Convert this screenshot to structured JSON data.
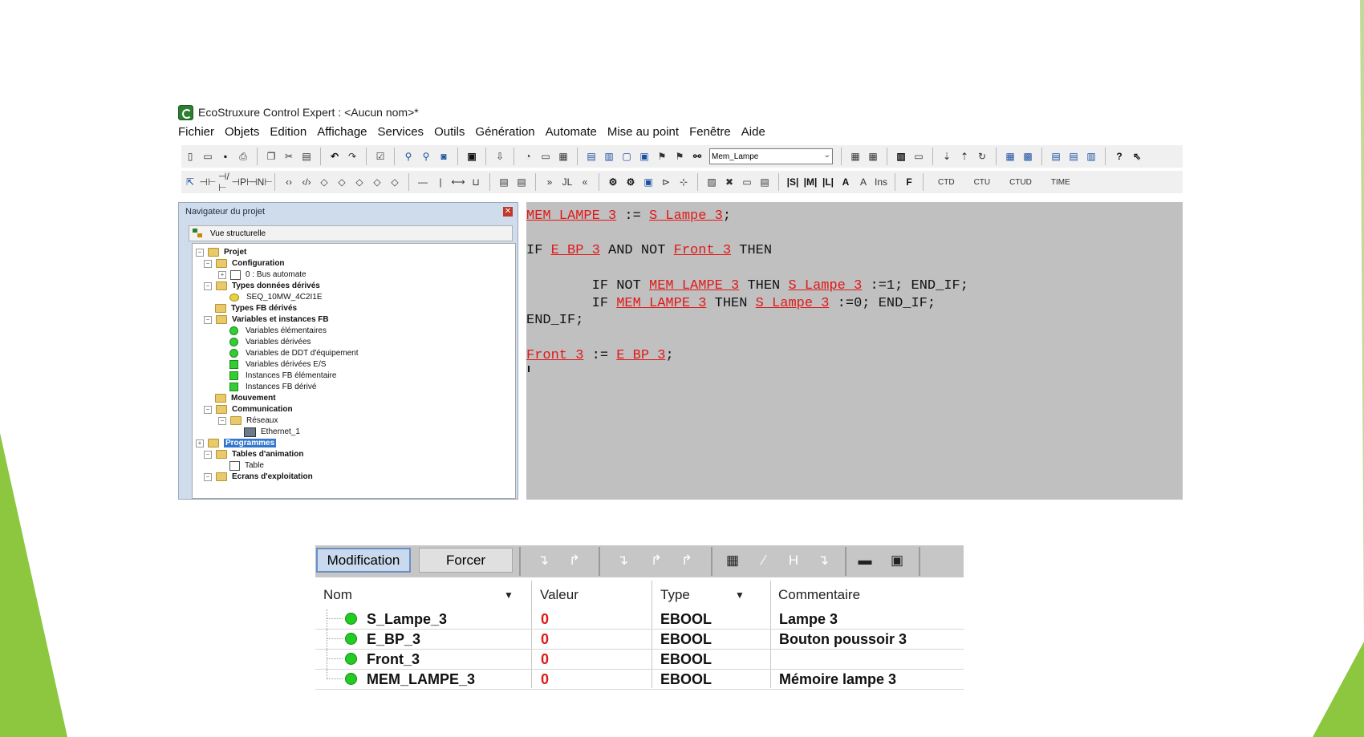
{
  "window": {
    "title": "EcoStruxure Control Expert : <Aucun nom>*"
  },
  "menu": [
    "Fichier",
    "Objets",
    "Edition",
    "Affichage",
    "Services",
    "Outils",
    "Génération",
    "Automate",
    "Mise au point",
    "Fenêtre",
    "Aide"
  ],
  "toolbar": {
    "search_value": "Mem_Lampe",
    "labels": [
      "Ins",
      "F",
      "CTD",
      "CTU",
      "CTUD",
      "TIME"
    ]
  },
  "navigator": {
    "title": "Navigateur du projet",
    "view_tab": "Vue structurelle",
    "tree": [
      {
        "label": "Projet",
        "bold": true
      },
      {
        "label": "Configuration",
        "bold": true
      },
      {
        "label": "0 : Bus automate",
        "bold": false
      },
      {
        "label": "Types données dérivés",
        "bold": true
      },
      {
        "label": "SEQ_10MW_4C2I1E",
        "bold": false
      },
      {
        "label": "Types FB dérivés",
        "bold": true
      },
      {
        "label": "Variables et instances FB",
        "bold": true
      },
      {
        "label": "Variables élémentaires",
        "bold": false
      },
      {
        "label": "Variables dérivées",
        "bold": false
      },
      {
        "label": "Variables de DDT d'équipement",
        "bold": false
      },
      {
        "label": "Variables dérivées E/S",
        "bold": false
      },
      {
        "label": "Instances FB élémentaire",
        "bold": false
      },
      {
        "label": "Instances FB dérivé",
        "bold": false
      },
      {
        "label": "Mouvement",
        "bold": true
      },
      {
        "label": "Communication",
        "bold": true
      },
      {
        "label": "Réseaux",
        "bold": false
      },
      {
        "label": "Ethernet_1",
        "bold": false
      },
      {
        "label": "Programmes",
        "bold": true,
        "selected": true
      },
      {
        "label": "Tables d'animation",
        "bold": true
      },
      {
        "label": "Table",
        "bold": false
      },
      {
        "label": "Ecrans d'exploitation",
        "bold": true
      }
    ]
  },
  "editor": {
    "lines": [
      [
        {
          "t": "MEM_LAMPE_3",
          "v": true
        },
        {
          "t": " := ",
          "v": false
        },
        {
          "t": "S_Lampe_3",
          "v": true
        },
        {
          "t": ";",
          "v": false
        }
      ],
      [],
      [
        {
          "t": "IF ",
          "v": false
        },
        {
          "t": "E_BP_3",
          "v": true
        },
        {
          "t": " AND NOT ",
          "v": false
        },
        {
          "t": "Front_3",
          "v": true
        },
        {
          "t": " THEN",
          "v": false
        }
      ],
      [],
      [
        {
          "t": "        IF NOT ",
          "v": false
        },
        {
          "t": "MEM_LAMPE_3",
          "v": true
        },
        {
          "t": " THEN ",
          "v": false
        },
        {
          "t": "S_Lampe_3",
          "v": true
        },
        {
          "t": " :=1; END_IF;",
          "v": false
        }
      ],
      [
        {
          "t": "        IF ",
          "v": false
        },
        {
          "t": "MEM_LAMPE_3",
          "v": true
        },
        {
          "t": " THEN ",
          "v": false
        },
        {
          "t": "S_Lampe_3",
          "v": true
        },
        {
          "t": " :=0; END_IF;",
          "v": false
        }
      ],
      [
        {
          "t": "END_IF;",
          "v": false
        }
      ],
      [],
      [
        {
          "t": "Front_3",
          "v": true
        },
        {
          "t": " := ",
          "v": false
        },
        {
          "t": "E_BP_3",
          "v": true
        },
        {
          "t": ";",
          "v": false
        }
      ]
    ]
  },
  "animation_table": {
    "buttons": {
      "modification": "Modification",
      "forcer": "Forcer"
    },
    "headers": {
      "nom": "Nom",
      "valeur": "Valeur",
      "type": "Type",
      "commentaire": "Commentaire"
    },
    "rows": [
      {
        "nom": "S_Lampe_3",
        "valeur": "0",
        "type": "EBOOL",
        "commentaire": "Lampe 3"
      },
      {
        "nom": "E_BP_3",
        "valeur": "0",
        "type": "EBOOL",
        "commentaire": "Bouton poussoir 3"
      },
      {
        "nom": "Front_3",
        "valeur": "0",
        "type": "EBOOL",
        "commentaire": ""
      },
      {
        "nom": "MEM_LAMPE_3",
        "valeur": "0",
        "type": "EBOOL",
        "commentaire": "Mémoire lampe 3"
      }
    ]
  },
  "colors": {
    "accent_green": "#8dc63f",
    "variable_red": "#e01818",
    "editor_bg": "#c0c0c0"
  }
}
